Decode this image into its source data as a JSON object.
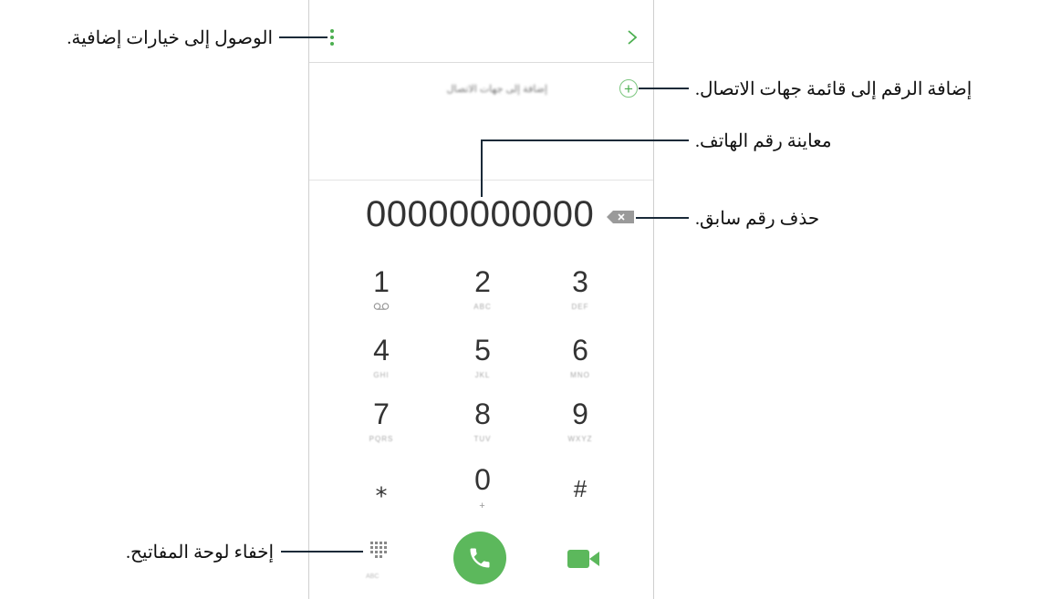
{
  "callouts": {
    "more_options": "الوصول إلى خيارات إضافية.",
    "add_to_contacts": "إضافة الرقم إلى قائمة جهات الاتصال.",
    "preview_number": "معاينة رقم الهاتف.",
    "delete_digit": "حذف رقم سابق.",
    "hide_keypad": "إخفاء لوحة المفاتيح."
  },
  "phone": {
    "add_to_contacts_label": "إضافة إلى جهات الاتصال",
    "number": "00000000000",
    "keys": [
      {
        "digit": "1",
        "sub": ""
      },
      {
        "digit": "2",
        "sub": "ABC"
      },
      {
        "digit": "3",
        "sub": "DEF"
      },
      {
        "digit": "4",
        "sub": "GHI"
      },
      {
        "digit": "5",
        "sub": "JKL"
      },
      {
        "digit": "6",
        "sub": "MNO"
      },
      {
        "digit": "7",
        "sub": "PQRS"
      },
      {
        "digit": "8",
        "sub": "TUV"
      },
      {
        "digit": "9",
        "sub": "WXYZ"
      },
      {
        "digit": "⁎",
        "sub": ""
      },
      {
        "digit": "0",
        "sub": "+"
      },
      {
        "digit": "#",
        "sub": ""
      }
    ],
    "keypad_sub": "ABC",
    "accent_color": "#5cb85c"
  }
}
